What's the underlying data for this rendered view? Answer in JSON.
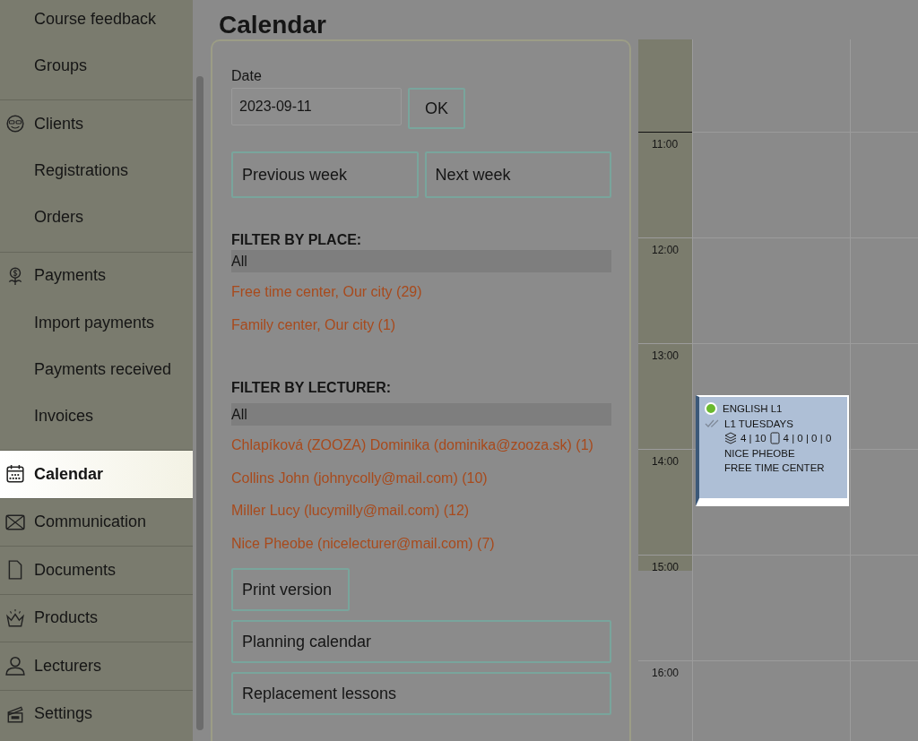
{
  "sidebar": {
    "items": [
      {
        "label": "Course feedback",
        "kind": "sub",
        "selected": false
      },
      {
        "label": "Groups",
        "kind": "sub",
        "selected": false
      },
      {
        "label": "Clients",
        "kind": "group",
        "selected": false
      },
      {
        "label": "Registrations",
        "kind": "sub",
        "selected": false
      },
      {
        "label": "Orders",
        "kind": "sub",
        "selected": false
      },
      {
        "label": "Payments",
        "kind": "group",
        "selected": false
      },
      {
        "label": "Import payments",
        "kind": "sub",
        "selected": false
      },
      {
        "label": "Payments received",
        "kind": "sub",
        "selected": false
      },
      {
        "label": "Invoices",
        "kind": "sub",
        "selected": false
      },
      {
        "label": "Calendar",
        "kind": "group",
        "selected": true
      },
      {
        "label": "Communication",
        "kind": "group",
        "selected": false
      },
      {
        "label": "Documents",
        "kind": "group",
        "selected": false
      },
      {
        "label": "Products",
        "kind": "group",
        "selected": false
      },
      {
        "label": "Lecturers",
        "kind": "group",
        "selected": false
      },
      {
        "label": "Settings",
        "kind": "group",
        "selected": false
      }
    ]
  },
  "page": {
    "title": "Calendar"
  },
  "filters": {
    "date_label": "Date",
    "date_value": "2023-09-11",
    "ok_button": "OK",
    "prev_button": "Previous week",
    "next_button": "Next week",
    "place_heading": "FILTER BY PLACE:",
    "places": [
      {
        "label": "All",
        "selected": true
      },
      {
        "label": "Free time center, Our city (29)",
        "selected": false
      },
      {
        "label": "Family center, Our city (1)",
        "selected": false
      }
    ],
    "lecturer_heading": "FILTER BY LECTURER:",
    "lecturers": [
      {
        "label": "All",
        "selected": true
      },
      {
        "label": "Chlapíková (ZOOZA) Dominika (dominika@zooza.sk) (1)",
        "selected": false
      },
      {
        "label": "Collins John (johnycolly@mail.com) (10)",
        "selected": false
      },
      {
        "label": "Miller Lucy (lucymilly@mail.com) (12)",
        "selected": false
      },
      {
        "label": "Nice Pheobe (nicelecturer@mail.com) (7)",
        "selected": false
      }
    ],
    "buttons": [
      "Print version",
      "Planning calendar",
      "Replacement lessons"
    ]
  },
  "calendar": {
    "times": [
      "11:00",
      "12:00",
      "13:00",
      "14:00",
      "15:00",
      "16:00"
    ],
    "events": [
      {
        "title": "ENGLISH L1",
        "color": "#6ab92f",
        "group": "L1 TUESDAYS",
        "registrations": "4 | 10",
        "attendance": "4 | 0 | 0 | 0",
        "lecturer": "NICE PHEOBE",
        "place": "FREE TIME CENTER"
      }
    ]
  }
}
